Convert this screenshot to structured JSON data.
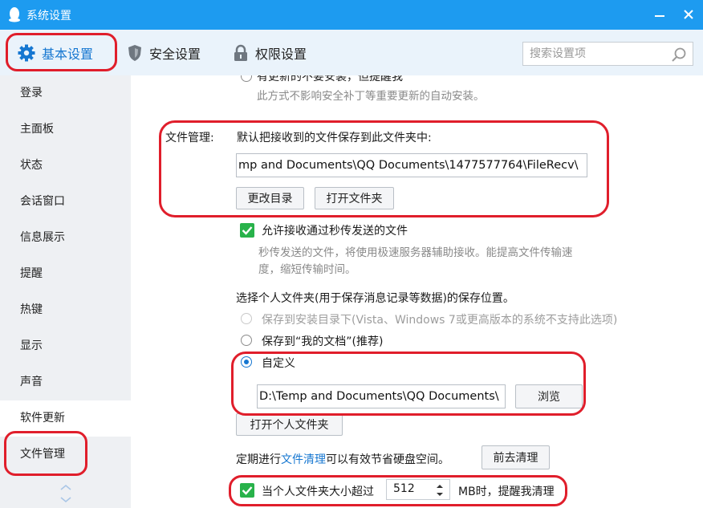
{
  "window": {
    "title": "系统设置"
  },
  "tabs": {
    "basic": "基本设置",
    "security": "安全设置",
    "permission": "权限设置"
  },
  "search": {
    "placeholder": "搜索设置项"
  },
  "sidebar": {
    "items": [
      {
        "label": "登录"
      },
      {
        "label": "主面板"
      },
      {
        "label": "状态"
      },
      {
        "label": "会话窗口"
      },
      {
        "label": "信息展示"
      },
      {
        "label": "提醒"
      },
      {
        "label": "热键"
      },
      {
        "label": "显示"
      },
      {
        "label": "声音"
      },
      {
        "label": "软件更新"
      },
      {
        "label": "文件管理"
      }
    ]
  },
  "update": {
    "partial_option": "有更新的不要安装，但提醒我",
    "note": "此方式不影响安全补丁等重要更新的自动安装。"
  },
  "file_management": {
    "section_label": "文件管理:",
    "save_desc": "默认把接收到的文件保存到此文件夹中:",
    "receive_path": "mp and Documents\\QQ Documents\\1477577764\\FileRecv\\",
    "change_dir_button": "更改目录",
    "open_folder_button": "打开文件夹",
    "allow_instant_label": "允许接收通过秒传发送的文件",
    "instant_note_1": "秒传发送的文件，将使用极速服务器辅助接收。能提高文件传输速",
    "instant_note_2": "度，缩短传输时间。",
    "personal_folder_desc": "选择个人文件夹(用于保存消息记录等数据)的保存位置。",
    "option_install_dir": "保存到安装目录下(Vista、Windows 7或更高版本的系统不支持此选项)",
    "option_my_docs": "保存到“我的文档”(推荐)",
    "option_custom": "自定义",
    "custom_path": "D:\\Temp and Documents\\QQ Documents\\",
    "browse_button": "浏览",
    "open_personal_button": "打开个人文件夹",
    "cleanup_prefix": "定期进行",
    "cleanup_link": "文件清理",
    "cleanup_suffix": "可以有效节省硬盘空间。",
    "cleanup_button": "前去清理",
    "size_warn_prefix": "当个人文件夹大小超过",
    "size_value": "512",
    "size_warn_suffix": "MB时，提醒我清理"
  },
  "colors": {
    "titlebar": "#1d9bf0",
    "accent": "#1677d1",
    "checkbox": "#28b24a",
    "annotation": "#e01e2b"
  },
  "icons": [
    "qq-penguin-icon",
    "minimize-icon",
    "close-icon",
    "gear-icon",
    "shield-icon",
    "lock-icon",
    "search-icon",
    "check-icon",
    "scroll-arrows-icon"
  ]
}
